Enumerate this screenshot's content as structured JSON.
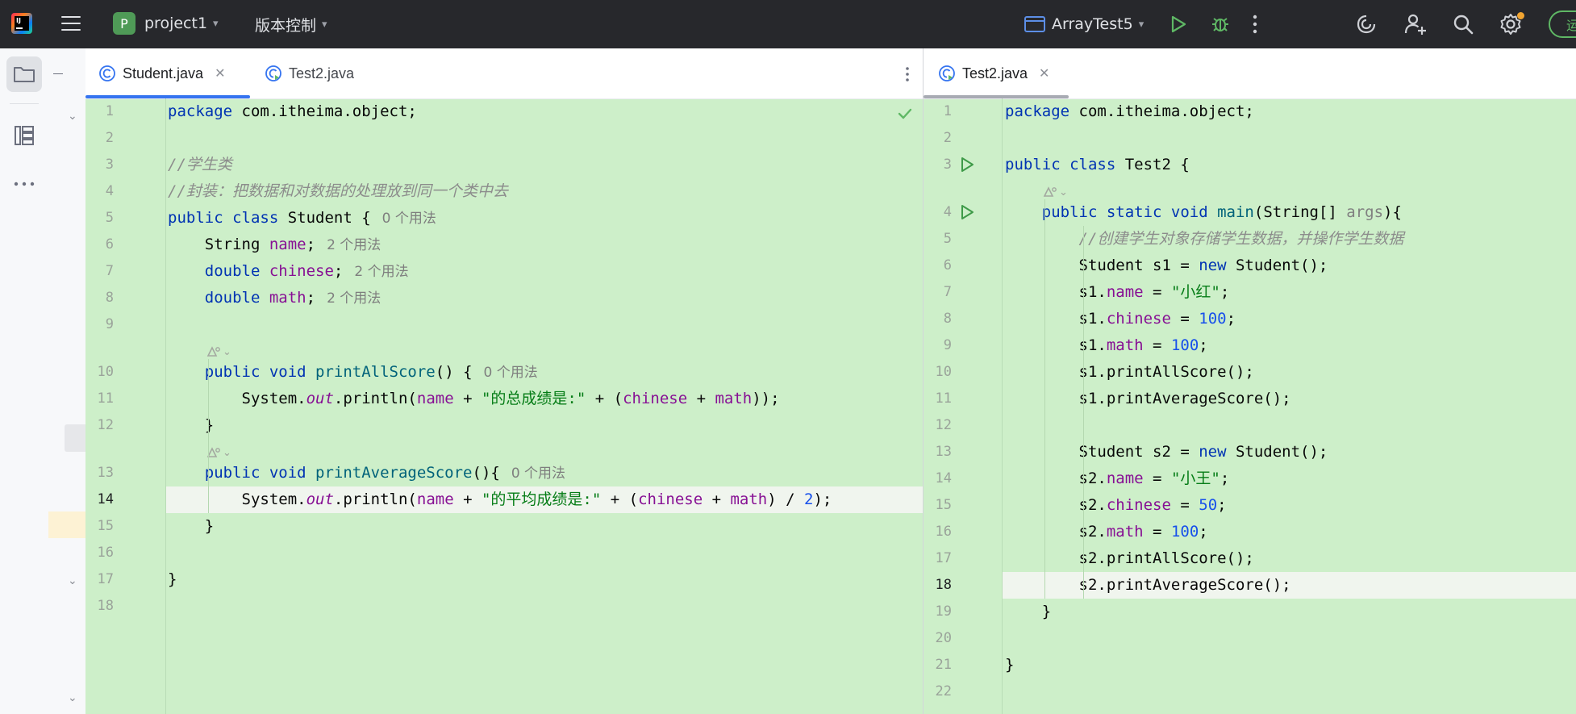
{
  "topbar": {
    "project_initial": "P",
    "project_name": "project1",
    "vcs_label": "版本控制",
    "run_config": "ArrayTest5",
    "partial_button": "运"
  },
  "icons": {
    "logo": "intellij-logo-icon",
    "menu": "hamburger-menu-icon",
    "run": "run-icon",
    "debug": "debug-icon",
    "more": "more-vertical-icon",
    "ai": "ai-assistant-icon",
    "add_user": "add-user-icon",
    "search": "search-icon",
    "settings": "gear-icon"
  },
  "colors": {
    "diff_green": "#cdefc9",
    "tab_active_underline": "#3574f0",
    "keyword": "#0033b3",
    "field": "#871094",
    "string": "#067d17",
    "number": "#1750eb",
    "comment": "#8c8c8c",
    "method": "#00627a",
    "settings_badge": "#f2a531"
  },
  "left_editor": {
    "tabs": [
      {
        "label": "Student.java",
        "active": true
      },
      {
        "label": "Test2.java",
        "active": false
      }
    ],
    "current_line": 14,
    "line_numbers": [
      "1",
      "2",
      "3",
      "4",
      "5",
      "6",
      "7",
      "8",
      "9",
      "10",
      "11",
      "12",
      "13",
      "14",
      "15",
      "16",
      "17",
      "18"
    ],
    "lines": [
      [
        {
          "t": "kw",
          "v": "package"
        },
        {
          "t": "p",
          "v": " com.itheima.object;"
        }
      ],
      [],
      [
        {
          "t": "cmt",
          "v": "//学生类"
        }
      ],
      [
        {
          "t": "cmt",
          "v": "//封装：把数据和对数据的处理放到同一个类中去"
        }
      ],
      [
        {
          "t": "kw",
          "v": "public class"
        },
        {
          "t": "p",
          "v": " Student {"
        },
        {
          "t": "hint",
          "v": "0 个用法"
        }
      ],
      [
        {
          "t": "p",
          "v": "    String "
        },
        {
          "t": "fld",
          "v": "name"
        },
        {
          "t": "p",
          "v": ";"
        },
        {
          "t": "hint",
          "v": "2 个用法"
        }
      ],
      [
        {
          "t": "kw",
          "v": "    double "
        },
        {
          "t": "fld",
          "v": "chinese"
        },
        {
          "t": "p",
          "v": ";"
        },
        {
          "t": "hint",
          "v": "2 个用法"
        }
      ],
      [
        {
          "t": "kw",
          "v": "    double "
        },
        {
          "t": "fld",
          "v": "math"
        },
        {
          "t": "p",
          "v": ";"
        },
        {
          "t": "hint",
          "v": "2 个用法"
        }
      ],
      [],
      [
        {
          "t": "kw",
          "v": "    public void "
        },
        {
          "t": "mth",
          "v": "printAllScore"
        },
        {
          "t": "p",
          "v": "() {"
        },
        {
          "t": "hint",
          "v": "0 个用法"
        }
      ],
      [
        {
          "t": "p",
          "v": "        System."
        },
        {
          "t": "sfld",
          "v": "out"
        },
        {
          "t": "p",
          "v": ".println("
        },
        {
          "t": "fld",
          "v": "name"
        },
        {
          "t": "p",
          "v": " + "
        },
        {
          "t": "str",
          "v": "\"的总成绩是:\""
        },
        {
          "t": "p",
          "v": " + ("
        },
        {
          "t": "fld",
          "v": "chinese"
        },
        {
          "t": "p",
          "v": " + "
        },
        {
          "t": "fld",
          "v": "math"
        },
        {
          "t": "p",
          "v": "));"
        }
      ],
      [
        {
          "t": "p",
          "v": "    }"
        }
      ],
      [
        {
          "t": "kw",
          "v": "    public void "
        },
        {
          "t": "mth",
          "v": "printAverageScore"
        },
        {
          "t": "p",
          "v": "(){"
        },
        {
          "t": "hint",
          "v": "0 个用法"
        }
      ],
      [
        {
          "t": "p",
          "v": "        System."
        },
        {
          "t": "sfld",
          "v": "out"
        },
        {
          "t": "p",
          "v": ".println("
        },
        {
          "t": "fld",
          "v": "name"
        },
        {
          "t": "p",
          "v": " + "
        },
        {
          "t": "str",
          "v": "\"的平均成绩是:\""
        },
        {
          "t": "p",
          "v": " + ("
        },
        {
          "t": "fld",
          "v": "chinese"
        },
        {
          "t": "p",
          "v": " + "
        },
        {
          "t": "fld",
          "v": "math"
        },
        {
          "t": "p",
          "v": ") / "
        },
        {
          "t": "num",
          "v": "2"
        },
        {
          "t": "p",
          "v": ");"
        }
      ],
      [
        {
          "t": "p",
          "v": "    }"
        }
      ],
      [],
      [
        {
          "t": "p",
          "v": "}"
        }
      ],
      []
    ]
  },
  "right_editor": {
    "tabs": [
      {
        "label": "Test2.java",
        "active": true
      }
    ],
    "current_line": 18,
    "line_numbers": [
      "1",
      "2",
      "3",
      "4",
      "5",
      "6",
      "7",
      "8",
      "9",
      "10",
      "11",
      "12",
      "13",
      "14",
      "15",
      "16",
      "17",
      "18",
      "19",
      "20",
      "21",
      "22"
    ],
    "lines": [
      [
        {
          "t": "kw",
          "v": "package"
        },
        {
          "t": "p",
          "v": " com.itheima.object;"
        }
      ],
      [],
      [
        {
          "t": "kw",
          "v": "public class"
        },
        {
          "t": "p",
          "v": " Test2 {"
        }
      ],
      [
        {
          "t": "kw",
          "v": "    public static void "
        },
        {
          "t": "mth",
          "v": "main"
        },
        {
          "t": "p",
          "v": "(String[] "
        },
        {
          "t": "prm",
          "v": "args"
        },
        {
          "t": "p",
          "v": "){"
        }
      ],
      [
        {
          "t": "cmt",
          "v": "        //创建学生对象存储学生数据，并操作学生数据"
        }
      ],
      [
        {
          "t": "p",
          "v": "        Student s1 = "
        },
        {
          "t": "kw",
          "v": "new"
        },
        {
          "t": "p",
          "v": " Student();"
        }
      ],
      [
        {
          "t": "p",
          "v": "        s1."
        },
        {
          "t": "fld",
          "v": "name"
        },
        {
          "t": "p",
          "v": " = "
        },
        {
          "t": "str",
          "v": "\"小红\""
        },
        {
          "t": "p",
          "v": ";"
        }
      ],
      [
        {
          "t": "p",
          "v": "        s1."
        },
        {
          "t": "fld",
          "v": "chinese"
        },
        {
          "t": "p",
          "v": " = "
        },
        {
          "t": "num",
          "v": "100"
        },
        {
          "t": "p",
          "v": ";"
        }
      ],
      [
        {
          "t": "p",
          "v": "        s1."
        },
        {
          "t": "fld",
          "v": "math"
        },
        {
          "t": "p",
          "v": " = "
        },
        {
          "t": "num",
          "v": "100"
        },
        {
          "t": "p",
          "v": ";"
        }
      ],
      [
        {
          "t": "p",
          "v": "        s1.printAllScore();"
        }
      ],
      [
        {
          "t": "p",
          "v": "        s1.printAverageScore();"
        }
      ],
      [],
      [
        {
          "t": "p",
          "v": "        Student s2 = "
        },
        {
          "t": "kw",
          "v": "new"
        },
        {
          "t": "p",
          "v": " Student();"
        }
      ],
      [
        {
          "t": "p",
          "v": "        s2."
        },
        {
          "t": "fld",
          "v": "name"
        },
        {
          "t": "p",
          "v": " = "
        },
        {
          "t": "str",
          "v": "\"小王\""
        },
        {
          "t": "p",
          "v": ";"
        }
      ],
      [
        {
          "t": "p",
          "v": "        s2."
        },
        {
          "t": "fld",
          "v": "chinese"
        },
        {
          "t": "p",
          "v": " = "
        },
        {
          "t": "num",
          "v": "50"
        },
        {
          "t": "p",
          "v": ";"
        }
      ],
      [
        {
          "t": "p",
          "v": "        s2."
        },
        {
          "t": "fld",
          "v": "math"
        },
        {
          "t": "p",
          "v": " = "
        },
        {
          "t": "num",
          "v": "100"
        },
        {
          "t": "p",
          "v": ";"
        }
      ],
      [
        {
          "t": "p",
          "v": "        s2.printAllScore();"
        }
      ],
      [
        {
          "t": "p",
          "v": "        s2.printAverageScore();"
        }
      ],
      [
        {
          "t": "p",
          "v": "    }"
        }
      ],
      [],
      [
        {
          "t": "p",
          "v": "}"
        }
      ],
      []
    ]
  }
}
